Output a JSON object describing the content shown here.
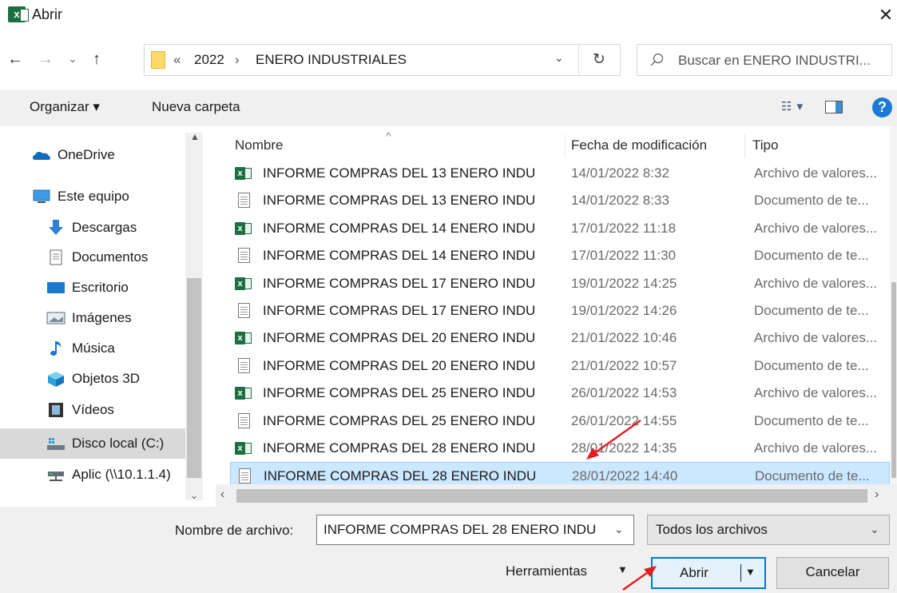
{
  "window": {
    "title": "Abrir",
    "close_glyph": "✕"
  },
  "address": {
    "separator": "«",
    "crumbs": [
      "2022",
      "ENERO INDUSTRIALES"
    ],
    "crumb_separator": "›",
    "refresh_glyph": "↻"
  },
  "search": {
    "placeholder": "Buscar en ENERO INDUSTRI..."
  },
  "toolbar": {
    "organize_label": "Organizar ▾",
    "new_folder_label": "Nueva carpeta",
    "help_glyph": "?"
  },
  "nav": {
    "items": [
      {
        "label": "OneDrive",
        "icon": "cloud-icon"
      },
      {
        "label": "Este equipo",
        "icon": "computer-icon"
      },
      {
        "label": "Descargas",
        "icon": "download-icon"
      },
      {
        "label": "Documentos",
        "icon": "documents-icon"
      },
      {
        "label": "Escritorio",
        "icon": "desktop-icon"
      },
      {
        "label": "Imágenes",
        "icon": "pictures-icon"
      },
      {
        "label": "Música",
        "icon": "music-icon"
      },
      {
        "label": "Objetos 3D",
        "icon": "objects-3d-icon"
      },
      {
        "label": "Vídeos",
        "icon": "videos-icon"
      },
      {
        "label": "Disco local (C:)",
        "icon": "local-disk-icon"
      },
      {
        "label": "Aplic (\\\\10.1.1.4)",
        "icon": "network-drive-icon"
      }
    ]
  },
  "columns": {
    "name": "Nombre",
    "date": "Fecha de modificación",
    "type": "Tipo"
  },
  "files": [
    {
      "name": "INFORME COMPRAS DEL 13 ENERO INDU",
      "date": "14/01/2022 8:32",
      "type": "Archivo de valores...",
      "kind": "xls"
    },
    {
      "name": "INFORME COMPRAS DEL 13 ENERO INDU",
      "date": "14/01/2022 8:33",
      "type": "Documento de te...",
      "kind": "txt"
    },
    {
      "name": "INFORME COMPRAS DEL 14 ENERO INDU",
      "date": "17/01/2022 11:18",
      "type": "Archivo de valores...",
      "kind": "xls"
    },
    {
      "name": "INFORME COMPRAS DEL 14 ENERO INDU",
      "date": "17/01/2022 11:30",
      "type": "Documento de te...",
      "kind": "txt"
    },
    {
      "name": "INFORME COMPRAS DEL 17 ENERO INDU",
      "date": "19/01/2022 14:25",
      "type": "Archivo de valores...",
      "kind": "xls"
    },
    {
      "name": "INFORME COMPRAS DEL 17 ENERO INDU",
      "date": "19/01/2022 14:26",
      "type": "Documento de te...",
      "kind": "txt"
    },
    {
      "name": "INFORME COMPRAS DEL 20 ENERO INDU",
      "date": "21/01/2022 10:46",
      "type": "Archivo de valores...",
      "kind": "xls"
    },
    {
      "name": "INFORME COMPRAS DEL 20 ENERO INDU",
      "date": "21/01/2022 10:57",
      "type": "Documento de te...",
      "kind": "txt"
    },
    {
      "name": "INFORME COMPRAS DEL 25 ENERO INDU",
      "date": "26/01/2022 14:53",
      "type": "Archivo de valores...",
      "kind": "xls"
    },
    {
      "name": "INFORME COMPRAS DEL 25 ENERO INDU",
      "date": "26/01/2022 14:55",
      "type": "Documento de te...",
      "kind": "txt"
    },
    {
      "name": "INFORME COMPRAS DEL 28 ENERO INDU",
      "date": "28/01/2022 14:35",
      "type": "Archivo de valores...",
      "kind": "xls"
    },
    {
      "name": "INFORME COMPRAS DEL 28 ENERO INDU",
      "date": "28/01/2022 14:40",
      "type": "Documento de te...",
      "kind": "txt",
      "selected": true
    }
  ],
  "footer": {
    "filename_label": "Nombre de archivo:",
    "filename_value": "INFORME COMPRAS DEL 28 ENERO INDU",
    "filter_value": "Todos los archivos",
    "tools_label": "Herramientas",
    "open_label": "Abrir",
    "cancel_label": "Cancelar"
  },
  "colors": {
    "accent": "#0078d7",
    "selection": "#cce8ff",
    "excel_green": "#1d6f42",
    "annotation_arrow": "#e02020"
  }
}
